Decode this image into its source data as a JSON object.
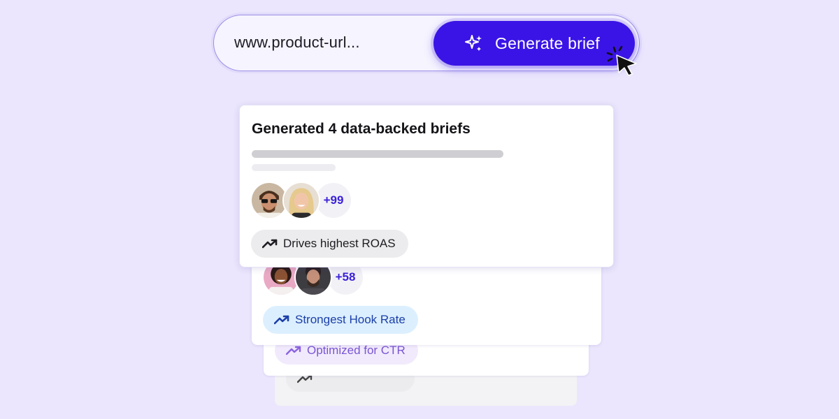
{
  "url_bar": {
    "url_text": "www.product-url...",
    "button_label": "Generate brief"
  },
  "cards": [
    {
      "title": "Generated 4 data-backed briefs",
      "more_count": "+99",
      "tag_label": "Drives highest ROAS"
    },
    {
      "more_count": "+58",
      "tag_label": "Strongest Hook Rate"
    },
    {
      "tag_label": "Optimized for CTR"
    }
  ],
  "colors": {
    "background": "#ebe6fd",
    "accent": "#3a14e6",
    "tag_blue": "#1b3fa8",
    "tag_purple": "#7a55d3"
  },
  "icons": [
    "sparkle-icon",
    "cursor-click-icon",
    "trending-up-icon"
  ]
}
